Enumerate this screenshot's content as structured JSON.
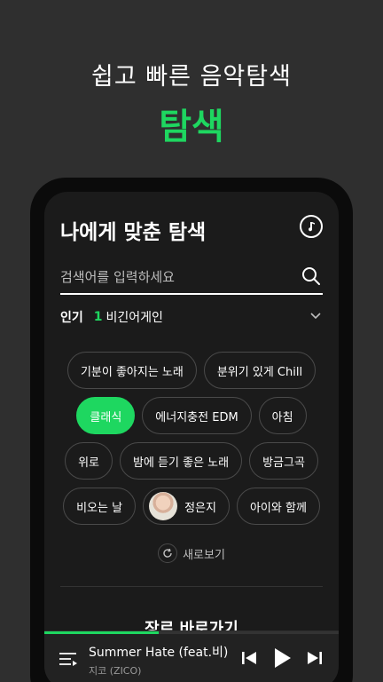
{
  "promo": {
    "subtitle": "쉽고 빠른 음악탐색",
    "title": "탐색"
  },
  "header": {
    "title": "나에게 맞춘 탐색"
  },
  "search": {
    "placeholder": "검색어를 입력하세요"
  },
  "popular": {
    "label": "인기",
    "rank": "1",
    "keyword": "비긴어게인"
  },
  "chips": [
    [
      "기분이 좋아지는 노래",
      "분위기 있게 Chill"
    ],
    [
      "클래식",
      "에너지충전 EDM",
      "아침"
    ],
    [
      "위로",
      "밤에 듣기 좋은 노래",
      "방금그곡"
    ],
    [
      "비오는 날",
      "정은지",
      "아이와 함께"
    ]
  ],
  "active_chip": "클래식",
  "refresh_label": "새로보기",
  "genre_heading": "장르 바로가기",
  "player": {
    "title": "Summer Hate (feat.비)",
    "artist": "지코 (ZICO)",
    "progress": 0.39
  },
  "colors": {
    "accent": "#1ed760",
    "background": "#2f2f2f",
    "screen": "#1b1b1b"
  },
  "icons": [
    "music-note-icon",
    "search-icon",
    "chevron-down-icon",
    "refresh-icon",
    "queue-icon",
    "previous-icon",
    "play-icon",
    "next-icon"
  ]
}
